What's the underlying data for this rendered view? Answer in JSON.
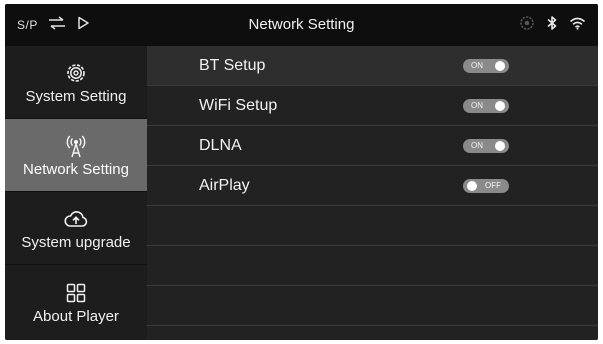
{
  "status_bar": {
    "sp_label": "S/P",
    "title": "Network Setting",
    "left_icons": [
      "swap-arrows-icon",
      "play-icon"
    ],
    "right_icons": [
      "gear-badge-icon",
      "bluetooth-icon",
      "wifi-icon"
    ]
  },
  "sidebar": {
    "items": [
      {
        "label": "System Setting",
        "icon": "gear-icon",
        "active": false
      },
      {
        "label": "Network Setting",
        "icon": "antenna-icon",
        "active": true
      },
      {
        "label": "System upgrade",
        "icon": "cloud-upload-icon",
        "active": false
      },
      {
        "label": "About Player",
        "icon": "grid-icon",
        "active": false
      }
    ]
  },
  "settings": {
    "rows": [
      {
        "label": "BT Setup",
        "toggle_text": "ON",
        "state": "on"
      },
      {
        "label": "WiFi Setup",
        "toggle_text": "ON",
        "state": "on"
      },
      {
        "label": "DLNA",
        "toggle_text": "ON",
        "state": "on"
      },
      {
        "label": "AirPlay",
        "toggle_text": "OFF",
        "state": "off"
      }
    ]
  },
  "colors": {
    "background": "#1c1c1c",
    "status_bar": "#0e0e0e",
    "active_item": "#6a6a6a",
    "toggle": "#8a8a8a"
  }
}
